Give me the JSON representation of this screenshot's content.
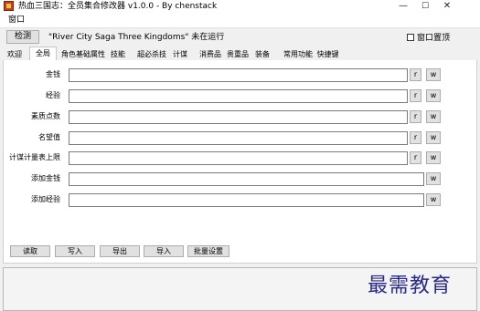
{
  "window": {
    "title": "热血三国志：全员集合修改器 v1.0.0 - By chenstack",
    "min_icon": "—",
    "max_icon": "☐",
    "close_icon": "✕"
  },
  "menu": {
    "items": [
      "窗口"
    ]
  },
  "toolbar": {
    "detect_label": "检测",
    "status_text": "\"River City Saga Three Kingdoms\" 未在运行",
    "topmost_label": "窗口置顶"
  },
  "tabs": [
    {
      "label": "欢迎"
    },
    {
      "label": "全局"
    },
    {
      "label": "角色基础属性"
    },
    {
      "label": "技能"
    },
    {
      "label": "超必杀技"
    },
    {
      "label": "计谋"
    },
    {
      "label": "消费品"
    },
    {
      "label": "贵重品"
    },
    {
      "label": "装备"
    },
    {
      "label": "常用功能"
    },
    {
      "label": "快捷键"
    }
  ],
  "active_tab": "全局",
  "fields": [
    {
      "label": "金钱",
      "value": "",
      "buttons": [
        "r",
        "w"
      ]
    },
    {
      "label": "经验",
      "value": "",
      "buttons": [
        "r",
        "w"
      ]
    },
    {
      "label": "素质点数",
      "value": "",
      "buttons": [
        "r",
        "w"
      ]
    },
    {
      "label": "名望值",
      "value": "",
      "buttons": [
        "r",
        "w"
      ]
    },
    {
      "label": "计谋计量表上限",
      "value": "",
      "buttons": [
        "r",
        "w"
      ]
    },
    {
      "label": "添加金钱",
      "value": "",
      "buttons": [
        "w"
      ]
    },
    {
      "label": "添加经验",
      "value": "",
      "buttons": [
        "w"
      ]
    }
  ],
  "bottom_buttons": [
    "读取",
    "写入",
    "导出",
    "导入",
    "批量设置"
  ],
  "watermark": "最需教育",
  "colors": {
    "watermark": "#2a2a8c",
    "app_icon": "#c8401c"
  }
}
